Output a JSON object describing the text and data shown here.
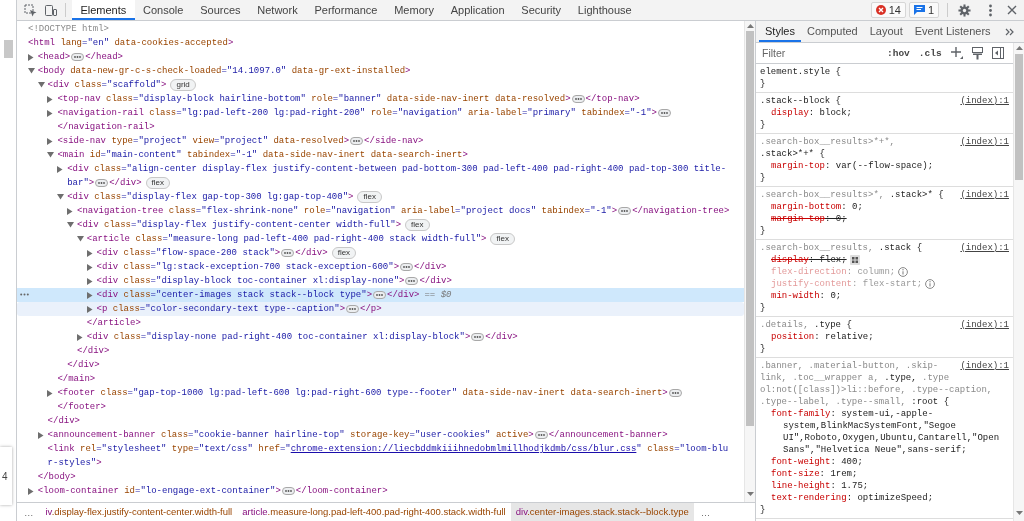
{
  "page_strip": {
    "label": "4"
  },
  "toolbar": {
    "tabs": [
      {
        "label": "Elements",
        "selected": true
      },
      {
        "label": "Console",
        "selected": false
      },
      {
        "label": "Sources",
        "selected": false
      },
      {
        "label": "Network",
        "selected": false
      },
      {
        "label": "Performance",
        "selected": false
      },
      {
        "label": "Memory",
        "selected": false
      },
      {
        "label": "Application",
        "selected": false
      },
      {
        "label": "Security",
        "selected": false
      },
      {
        "label": "Lighthouse",
        "selected": false
      }
    ],
    "errors": "14",
    "messages": "1"
  },
  "dom_tree": [
    {
      "kind": "plain",
      "selected": false,
      "hovered": false,
      "tokens": [
        {
          "kind": "doctype",
          "text": "<!DOCTYPE html>"
        }
      ]
    },
    {
      "kind": "plain",
      "selected": false,
      "hovered": false,
      "tokens": [
        {
          "kind": "tag",
          "text": "<html"
        },
        {
          "kind": "attr",
          "text": " lang"
        },
        {
          "kind": "value",
          "text": "=\"en\""
        },
        {
          "kind": "attr",
          "text": " data-cookies-accepted"
        },
        {
          "kind": "tag",
          "text": ">"
        }
      ],
      "children": [
        {
          "kind": "element",
          "expanded": false,
          "selected": false,
          "hovered": false,
          "tokens": [
            {
              "kind": "tag",
              "text": "<head>"
            }
          ],
          "close": "</head>"
        },
        {
          "kind": "element",
          "expanded": true,
          "selected": false,
          "hovered": false,
          "tokens": [
            {
              "kind": "tag",
              "text": "<body"
            },
            {
              "kind": "attr",
              "text": " data-new-gr-c-s-check-loaded"
            },
            {
              "kind": "value",
              "text": "=\"14.1097.0\""
            },
            {
              "kind": "attr",
              "text": " data-gr-ext-installed"
            },
            {
              "kind": "tag",
              "text": ">"
            }
          ],
          "close": "</body>",
          "children": [
            {
              "kind": "element",
              "expanded": true,
              "selected": false,
              "hovered": false,
              "tokens": [
                {
                  "kind": "tag",
                  "text": "<div"
                },
                {
                  "kind": "attr",
                  "text": " class"
                },
                {
                  "kind": "value",
                  "text": "=\"scaffold\""
                },
                {
                  "kind": "tag",
                  "text": ">"
                }
              ],
              "badge": "grid",
              "close": "</div>",
              "children": [
                {
                  "kind": "element",
                  "expanded": false,
                  "selected": false,
                  "hovered": false,
                  "tokens": [
                    {
                      "kind": "tag",
                      "text": "<top-nav"
                    },
                    {
                      "kind": "attr",
                      "text": " class"
                    },
                    {
                      "kind": "value",
                      "text": "=\"display-block hairline-bottom\""
                    },
                    {
                      "kind": "attr",
                      "text": " role"
                    },
                    {
                      "kind": "value",
                      "text": "=\"banner\""
                    },
                    {
                      "kind": "attr",
                      "text": " data-side-nav-inert"
                    },
                    {
                      "kind": "attr",
                      "text": " data-resolved"
                    },
                    {
                      "kind": "tag",
                      "text": ">"
                    }
                  ],
                  "close": "</top-nav>"
                },
                {
                  "kind": "element",
                  "expanded": false,
                  "selected": false,
                  "hovered": false,
                  "tokens": [
                    {
                      "kind": "tag",
                      "text": "<navigation-rail"
                    },
                    {
                      "kind": "attr",
                      "text": " class"
                    },
                    {
                      "kind": "value",
                      "text": "=\"lg:pad-left-200 lg:pad-right-200\""
                    },
                    {
                      "kind": "attr",
                      "text": " role"
                    },
                    {
                      "kind": "value",
                      "text": "=\"navigation\""
                    },
                    {
                      "kind": "attr",
                      "text": " aria-label"
                    },
                    {
                      "kind": "value",
                      "text": "=\"primary\""
                    },
                    {
                      "kind": "attr",
                      "text": " tabindex"
                    },
                    {
                      "kind": "value",
                      "text": "=\"-1\""
                    },
                    {
                      "kind": "tag",
                      "text": ">"
                    }
                  ],
                  "close": "</navigation-rail>",
                  "close_wraps": true
                },
                {
                  "kind": "element",
                  "expanded": false,
                  "selected": false,
                  "hovered": false,
                  "tokens": [
                    {
                      "kind": "tag",
                      "text": "<side-nav"
                    },
                    {
                      "kind": "attr",
                      "text": " type"
                    },
                    {
                      "kind": "value",
                      "text": "=\"project\""
                    },
                    {
                      "kind": "attr",
                      "text": " view"
                    },
                    {
                      "kind": "value",
                      "text": "=\"project\""
                    },
                    {
                      "kind": "attr",
                      "text": " data-resolved"
                    },
                    {
                      "kind": "tag",
                      "text": ">"
                    }
                  ],
                  "close": "</side-nav>"
                },
                {
                  "kind": "element",
                  "expanded": true,
                  "selected": false,
                  "hovered": false,
                  "tokens": [
                    {
                      "kind": "tag",
                      "text": "<main"
                    },
                    {
                      "kind": "attr",
                      "text": " id"
                    },
                    {
                      "kind": "value",
                      "text": "=\"main-content\""
                    },
                    {
                      "kind": "attr",
                      "text": " tabindex"
                    },
                    {
                      "kind": "value",
                      "text": "=\"-1\""
                    },
                    {
                      "kind": "attr",
                      "text": " data-side-nav-inert"
                    },
                    {
                      "kind": "attr",
                      "text": " data-search-inert"
                    },
                    {
                      "kind": "tag",
                      "text": ">"
                    }
                  ],
                  "close": "</main>",
                  "children": [
                    {
                      "kind": "element",
                      "expanded": false,
                      "selected": false,
                      "hovered": false,
                      "tokens": [
                        {
                          "kind": "tag",
                          "text": "<div"
                        },
                        {
                          "kind": "attr",
                          "text": " class"
                        },
                        {
                          "kind": "value",
                          "text": "=\"align-center display-flex justify-content-between pad-bottom-300 pad-left-400 pad-right-400 pad-top-300 title-\nbar\""
                        },
                        {
                          "kind": "tag",
                          "text": ">"
                        }
                      ],
                      "close": "</div>",
                      "badge": "flex"
                    },
                    {
                      "kind": "element",
                      "expanded": true,
                      "selected": false,
                      "hovered": false,
                      "tokens": [
                        {
                          "kind": "tag",
                          "text": "<div"
                        },
                        {
                          "kind": "attr",
                          "text": " class"
                        },
                        {
                          "kind": "value",
                          "text": "=\"display-flex gap-top-300 lg:gap-top-400\""
                        },
                        {
                          "kind": "tag",
                          "text": ">"
                        }
                      ],
                      "badge": "flex",
                      "close": "</div>",
                      "children": [
                        {
                          "kind": "element",
                          "expanded": false,
                          "selected": false,
                          "hovered": false,
                          "tokens": [
                            {
                              "kind": "tag",
                              "text": "<navigation-tree"
                            },
                            {
                              "kind": "attr",
                              "text": " class"
                            },
                            {
                              "kind": "value",
                              "text": "=\"flex-shrink-none\""
                            },
                            {
                              "kind": "attr",
                              "text": " role"
                            },
                            {
                              "kind": "value",
                              "text": "=\"navigation\""
                            },
                            {
                              "kind": "attr",
                              "text": " aria-label"
                            },
                            {
                              "kind": "value",
                              "text": "=\"project docs\""
                            },
                            {
                              "kind": "attr",
                              "text": " tabindex"
                            },
                            {
                              "kind": "value",
                              "text": "=\"-1\""
                            },
                            {
                              "kind": "tag",
                              "text": ">"
                            }
                          ],
                          "close": "</navigation-tree>"
                        },
                        {
                          "kind": "element",
                          "expanded": true,
                          "selected": false,
                          "hovered": false,
                          "tokens": [
                            {
                              "kind": "tag",
                              "text": "<div"
                            },
                            {
                              "kind": "attr",
                              "text": " class"
                            },
                            {
                              "kind": "value",
                              "text": "=\"display-flex justify-content-center width-full\""
                            },
                            {
                              "kind": "tag",
                              "text": ">"
                            }
                          ],
                          "badge": "flex",
                          "close": "</div>",
                          "children": [
                            {
                              "kind": "element",
                              "expanded": true,
                              "selected": false,
                              "hovered": false,
                              "tokens": [
                                {
                                  "kind": "tag",
                                  "text": "<article"
                                },
                                {
                                  "kind": "attr",
                                  "text": " class"
                                },
                                {
                                  "kind": "value",
                                  "text": "=\"measure-long pad-left-400 pad-right-400 stack width-full\""
                                },
                                {
                                  "kind": "tag",
                                  "text": ">"
                                }
                              ],
                              "badge": "flex",
                              "close": "</article>",
                              "children": [
                                {
                                  "kind": "element",
                                  "expanded": false,
                                  "selected": false,
                                  "hovered": false,
                                  "tokens": [
                                    {
                                      "kind": "tag",
                                      "text": "<div"
                                    },
                                    {
                                      "kind": "attr",
                                      "text": " class"
                                    },
                                    {
                                      "kind": "value",
                                      "text": "=\"flow-space-200 stack\""
                                    },
                                    {
                                      "kind": "tag",
                                      "text": ">"
                                    }
                                  ],
                                  "close": "</div>",
                                  "badge": "flex"
                                },
                                {
                                  "kind": "element",
                                  "expanded": false,
                                  "selected": false,
                                  "hovered": false,
                                  "tokens": [
                                    {
                                      "kind": "tag",
                                      "text": "<div"
                                    },
                                    {
                                      "kind": "attr",
                                      "text": " class"
                                    },
                                    {
                                      "kind": "value",
                                      "text": "=\"lg:stack-exception-700 stack-exception-600\""
                                    },
                                    {
                                      "kind": "tag",
                                      "text": ">"
                                    }
                                  ],
                                  "close": "</div>"
                                },
                                {
                                  "kind": "element",
                                  "expanded": false,
                                  "selected": false,
                                  "hovered": false,
                                  "tokens": [
                                    {
                                      "kind": "tag",
                                      "text": "<div"
                                    },
                                    {
                                      "kind": "attr",
                                      "text": " class"
                                    },
                                    {
                                      "kind": "value",
                                      "text": "=\"display-block toc-container xl:display-none\""
                                    },
                                    {
                                      "kind": "tag",
                                      "text": ">"
                                    }
                                  ],
                                  "close": "</div>"
                                },
                                {
                                  "kind": "element",
                                  "expanded": false,
                                  "selected": true,
                                  "hovered": false,
                                  "tokens": [
                                    {
                                      "kind": "tag",
                                      "text": "<div"
                                    },
                                    {
                                      "kind": "attr",
                                      "text": " class"
                                    },
                                    {
                                      "kind": "value",
                                      "text": "=\"center-images stack stack--block type\""
                                    },
                                    {
                                      "kind": "tag",
                                      "text": ">"
                                    }
                                  ],
                                  "close": "</div>",
                                  "ref": "== $0"
                                },
                                {
                                  "kind": "element",
                                  "expanded": false,
                                  "selected": false,
                                  "hovered": true,
                                  "tokens": [
                                    {
                                      "kind": "tag",
                                      "text": "<p"
                                    },
                                    {
                                      "kind": "attr",
                                      "text": " class"
                                    },
                                    {
                                      "kind": "value",
                                      "text": "=\"color-secondary-text type--caption\""
                                    },
                                    {
                                      "kind": "tag",
                                      "text": ">"
                                    }
                                  ],
                                  "close": "</p>"
                                }
                              ]
                            },
                            {
                              "kind": "element",
                              "expanded": false,
                              "selected": false,
                              "hovered": false,
                              "tokens": [
                                {
                                  "kind": "tag",
                                  "text": "<div"
                                },
                                {
                                  "kind": "attr",
                                  "text": " class"
                                },
                                {
                                  "kind": "value",
                                  "text": "=\"display-none pad-right-400 toc-container xl:display-block\""
                                },
                                {
                                  "kind": "tag",
                                  "text": ">"
                                }
                              ],
                              "close": "</div>"
                            }
                          ]
                        }
                      ]
                    }
                  ]
                },
                {
                  "kind": "element",
                  "expanded": false,
                  "selected": false,
                  "hovered": false,
                  "tokens": [
                    {
                      "kind": "tag",
                      "text": "<footer"
                    },
                    {
                      "kind": "attr",
                      "text": " class"
                    },
                    {
                      "kind": "value",
                      "text": "=\"gap-top-1000 lg:pad-left-600 lg:pad-right-600 type--footer\""
                    },
                    {
                      "kind": "attr",
                      "text": " data-side-nav-inert"
                    },
                    {
                      "kind": "attr",
                      "text": " data-search-inert"
                    },
                    {
                      "kind": "tag",
                      "text": ">"
                    }
                  ],
                  "close": "</footer>",
                  "close_wraps": true
                }
              ]
            },
            {
              "kind": "element",
              "expanded": false,
              "selected": false,
              "hovered": false,
              "tokens": [
                {
                  "kind": "tag",
                  "text": "<announcement-banner"
                },
                {
                  "kind": "attr",
                  "text": " class"
                },
                {
                  "kind": "value",
                  "text": "=\"cookie-banner hairline-top\""
                },
                {
                  "kind": "attr",
                  "text": " storage-key"
                },
                {
                  "kind": "value",
                  "text": "=\"user-cookies\""
                },
                {
                  "kind": "attr",
                  "text": " active"
                },
                {
                  "kind": "tag",
                  "text": ">"
                }
              ],
              "close": "</announcement-banner>"
            },
            {
              "kind": "plain",
              "selected": false,
              "hovered": false,
              "tokens": [
                {
                  "kind": "tag",
                  "text": "<link"
                },
                {
                  "kind": "attr",
                  "text": " rel"
                },
                {
                  "kind": "value",
                  "text": "=\"stylesheet\""
                },
                {
                  "kind": "attr",
                  "text": " type"
                },
                {
                  "kind": "value",
                  "text": "=\"text/css\""
                },
                {
                  "kind": "attr",
                  "text": " href"
                },
                {
                  "kind": "value",
                  "text": "=\""
                },
                {
                  "kind": "link",
                  "text": "chrome-extension://liecbddmkiiihnedobmlmillhodjkdmb/css/blur.css"
                },
                {
                  "kind": "value",
                  "text": "\""
                },
                {
                  "kind": "attr",
                  "text": " class"
                },
                {
                  "kind": "value",
                  "text": "=\"loom-blu\nr-styles\""
                },
                {
                  "kind": "tag",
                  "text": ">"
                }
              ]
            }
          ]
        },
        {
          "kind": "element",
          "expanded": false,
          "selected": false,
          "hovered": false,
          "tokens": [
            {
              "kind": "tag",
              "text": "<loom-container"
            },
            {
              "kind": "attr",
              "text": " id"
            },
            {
              "kind": "value",
              "text": "=\"lo-engage-ext-container\""
            },
            {
              "kind": "tag",
              "text": ">"
            }
          ],
          "close": "</loom-container>"
        }
      ]
    }
  ],
  "breadcrumbs": {
    "leading": "…",
    "trailing": "…",
    "crumbs": [
      {
        "tag": "iv",
        "classes": ".display-flex.justify-content-center.width-full",
        "selected": false
      },
      {
        "tag": "article",
        "classes": ".measure-long.pad-left-400.pad-right-400.stack.width-full",
        "selected": false
      },
      {
        "tag": "div",
        "classes": ".center-images.stack.stack--block.type",
        "selected": true
      }
    ]
  },
  "styles_pane": {
    "tabs": [
      {
        "label": "Styles",
        "selected": true
      },
      {
        "label": "Computed",
        "selected": false
      },
      {
        "label": "Layout",
        "selected": false
      },
      {
        "label": "Event Listeners",
        "selected": false
      }
    ],
    "filter": {
      "placeholder": "Filter"
    },
    "toggles": [
      {
        "label": ":hov"
      },
      {
        "label": ".cls"
      }
    ],
    "rules": [
      {
        "selector": [
          [
            {
              "text": "element.style {",
              "matched": true
            }
          ]
        ],
        "close": "}"
      },
      {
        "selector": [
          [
            {
              "text": ".stack--block {",
              "matched": true
            }
          ]
        ],
        "source": "(index):1",
        "declarations": [
          {
            "name": "display",
            "value": ": block;",
            "kind": "plain",
            "overridden": false,
            "inactive": false
          }
        ],
        "close": "}"
      },
      {
        "selector": [
          [
            {
              "text": ".search-box__results>*+*,",
              "matched": false
            }
          ],
          [
            {
              "text": ".stack>*+* {",
              "matched": true
            }
          ]
        ],
        "source": "(index):1",
        "declarations": [
          {
            "name": "margin-top",
            "value": ": var(--flow-space);",
            "kind": "plain",
            "overridden": false,
            "inactive": false
          }
        ],
        "close": "}"
      },
      {
        "selector": [
          [
            {
              "text": ".search-box__results>*,",
              "matched": false
            },
            {
              "text": " .stack>* {",
              "matched": true
            }
          ]
        ],
        "source": "(index):1",
        "declarations": [
          {
            "name": "margin-bottom",
            "value": ": 0;",
            "kind": "plain",
            "overridden": false,
            "inactive": false
          },
          {
            "name": "margin-top",
            "value": ": 0;",
            "kind": "plain",
            "overridden": true,
            "inactive": false
          }
        ],
        "close": "}"
      },
      {
        "selector": [
          [
            {
              "text": ".search-box__results,",
              "matched": false
            },
            {
              "text": " .stack {",
              "matched": true
            }
          ]
        ],
        "source": "(index):1",
        "declarations": [
          {
            "name": "display",
            "value": ": flex;",
            "kind": "flex",
            "overridden": true,
            "inactive": false
          },
          {
            "name": "flex-direction",
            "value": ": column;",
            "kind": "info",
            "overridden": false,
            "inactive": true
          },
          {
            "name": "justify-content",
            "value": ": flex-start;",
            "kind": "info",
            "overridden": false,
            "inactive": true
          },
          {
            "name": "min-width",
            "value": ": 0;",
            "kind": "plain",
            "overridden": false,
            "inactive": false
          }
        ],
        "close": "}"
      },
      {
        "selector": [
          [
            {
              "text": ".details,",
              "matched": false
            },
            {
              "text": " .type {",
              "matched": true
            }
          ]
        ],
        "source": "(index):1",
        "declarations": [
          {
            "name": "position",
            "value": ": relative;",
            "kind": "plain",
            "overridden": false,
            "inactive": false
          }
        ],
        "close": "}"
      },
      {
        "selector": [
          [
            {
              "text": ".banner, .material-button, .skip-",
              "matched": false
            }
          ],
          [
            {
              "text": "link, .toc__wrapper a,",
              "matched": false
            },
            {
              "text": " .type,",
              "matched": true
            },
            {
              "text": " .type",
              "matched": false
            }
          ],
          [
            {
              "text": "ol:not([class])>li::before, .type--caption,",
              "matched": false
            }
          ],
          [
            {
              "text": ".type--label, .type--small,",
              "matched": false
            },
            {
              "text": " :root {",
              "matched": true
            }
          ]
        ],
        "source": "(index):1",
        "declarations": [
          {
            "name": "font-family",
            "value": ": system-ui,-apple-\nsystem,BlinkMacSystemFont,\"Segoe\nUI\",Roboto,Oxygen,Ubuntu,Cantarell,\"Open\nSans\",\"Helvetica Neue\",sans-serif;",
            "kind": "plain",
            "overridden": false,
            "inactive": false
          },
          {
            "name": "font-weight",
            "value": ": 400;",
            "kind": "plain",
            "overridden": false,
            "inactive": false
          },
          {
            "name": "font-size",
            "value": ": 1rem;",
            "kind": "plain",
            "overridden": false,
            "inactive": false
          },
          {
            "name": "line-height",
            "value": ": 1.75;",
            "kind": "plain",
            "overridden": false,
            "inactive": false
          },
          {
            "name": "text-rendering",
            "value": ": optimizeSpeed;",
            "kind": "plain",
            "overridden": false,
            "inactive": false
          }
        ],
        "close": "}"
      }
    ]
  }
}
